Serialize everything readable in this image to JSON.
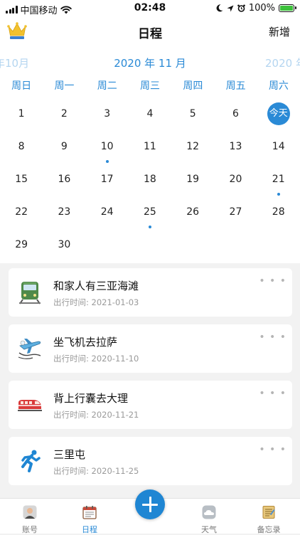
{
  "status_bar": {
    "carrier": "中国移动",
    "time": "02:48",
    "battery": "100%",
    "battery_level": 1.0
  },
  "nav": {
    "title": "日程",
    "add_label": "新增"
  },
  "calendar": {
    "prev_month": "年10月",
    "current_month": "2020 年 11 月",
    "next_month": "2020 年",
    "weekdays": [
      "周日",
      "周一",
      "周二",
      "周三",
      "周四",
      "周五",
      "周六"
    ],
    "days": [
      {
        "label": "1"
      },
      {
        "label": "2"
      },
      {
        "label": "3"
      },
      {
        "label": "4"
      },
      {
        "label": "5"
      },
      {
        "label": "6"
      },
      {
        "label": "今天",
        "today": true
      },
      {
        "label": "8"
      },
      {
        "label": "9"
      },
      {
        "label": "10",
        "event": true
      },
      {
        "label": "11"
      },
      {
        "label": "12"
      },
      {
        "label": "13"
      },
      {
        "label": "14"
      },
      {
        "label": "15"
      },
      {
        "label": "16"
      },
      {
        "label": "17"
      },
      {
        "label": "18"
      },
      {
        "label": "19"
      },
      {
        "label": "20"
      },
      {
        "label": "21",
        "event": true
      },
      {
        "label": "22"
      },
      {
        "label": "23"
      },
      {
        "label": "24"
      },
      {
        "label": "25",
        "event": true
      },
      {
        "label": "26"
      },
      {
        "label": "27"
      },
      {
        "label": "28"
      },
      {
        "label": "29"
      },
      {
        "label": "30"
      }
    ]
  },
  "trips": [
    {
      "icon": "train-icon",
      "title": "和家人有三亚海滩",
      "date_label": "出行时间:",
      "date": "2021-01-03"
    },
    {
      "icon": "airplane-icon",
      "title": "坐飞机去拉萨",
      "date_label": "出行时间:",
      "date": "2020-11-10"
    },
    {
      "icon": "bullet-train-icon",
      "title": "背上行囊去大理",
      "date_label": "出行时间:",
      "date": "2020-11-21"
    },
    {
      "icon": "runner-icon",
      "title": "三里屯",
      "date_label": "出行时间:",
      "date": "2020-11-25"
    }
  ],
  "more_glyph": "• • •",
  "tabs": [
    {
      "label": "账号",
      "icon": "account-avatar-icon"
    },
    {
      "label": "日程",
      "icon": "calendar-icon",
      "active": true
    },
    {
      "label": "天气",
      "icon": "weather-icon"
    },
    {
      "label": "备忘录",
      "icon": "notebook-icon"
    }
  ],
  "accent_color": "#2a8ad6"
}
